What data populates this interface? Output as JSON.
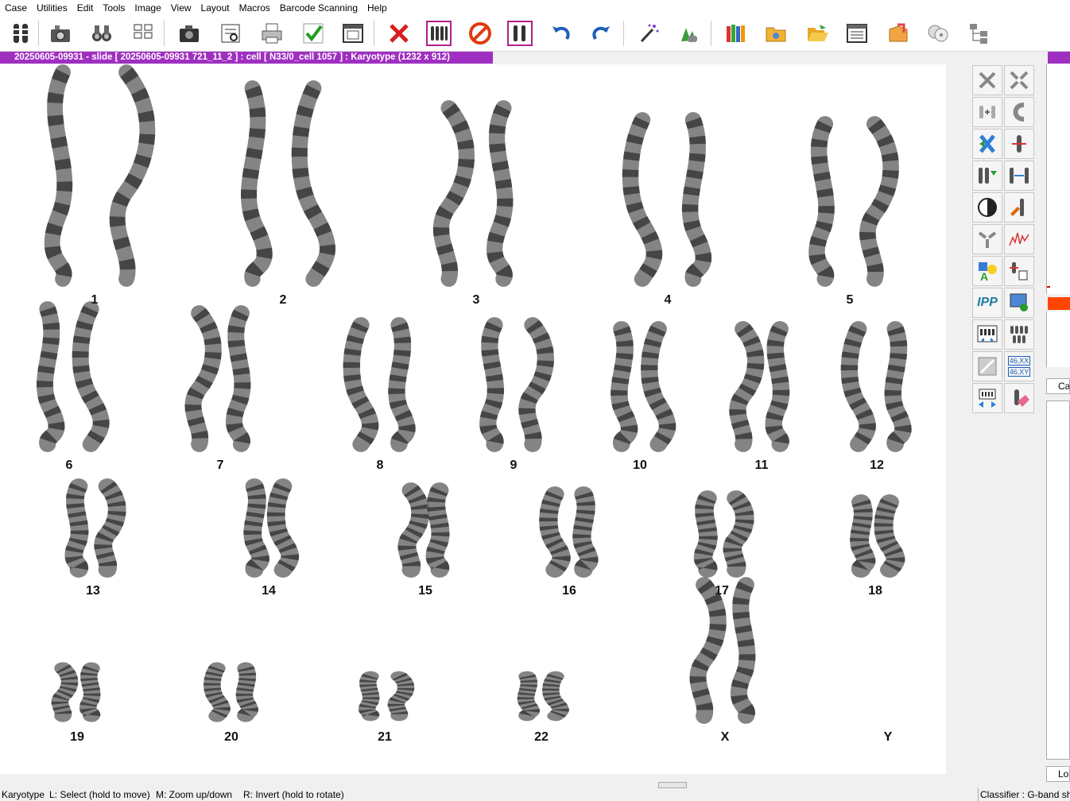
{
  "menu": [
    "Case",
    "Utilities",
    "Edit",
    "Tools",
    "Image",
    "View",
    "Layout",
    "Macros",
    "Barcode Scanning",
    "Help"
  ],
  "toolbar_icons": [
    "karyotype-icon",
    "capture-camera-icon",
    "binoculars-icon",
    "layout-grid-icon",
    "camera-icon",
    "inspect-icon",
    "print-icon",
    "checkmark-icon",
    "window-icon",
    "delete-x-icon",
    "karyotype-select-icon",
    "forbidden-icon",
    "chromosome-pair-icon",
    "undo-icon",
    "redo-icon",
    "magic-wand-icon",
    "pointing-hand-icon",
    "book-library-icon",
    "settings-folder-icon",
    "open-folder-icon",
    "report-icon",
    "export-icon",
    "discs-icon",
    "tree-icon"
  ],
  "window_title": "20250605-09931 - slide [ 20250605-09931 721_11_2 ] : cell [ N33/0_cell 1057 ] : Karyotype  (1232 x 912)",
  "chromosome_labels": [
    "1",
    "2",
    "3",
    "4",
    "5",
    "6",
    "7",
    "8",
    "9",
    "10",
    "11",
    "12",
    "13",
    "14",
    "15",
    "16",
    "17",
    "18",
    "19",
    "20",
    "21",
    "22",
    "X",
    "Y"
  ],
  "side_tools": [
    "delete-icon",
    "split-icon",
    "join-icon",
    "bend-icon",
    "swap-icon",
    "cut-chromosome-icon",
    "rearrange-icon",
    "stretch-icon",
    "contrast-icon",
    "paint-icon",
    "straighten-icon",
    "profile-icon",
    "annotate-icon",
    "hand-grab-icon",
    "ipp-icon",
    "monitor-icon",
    "karyotype-grid-icon",
    "pairs-icon",
    "measure-icon",
    "sex-karyotype-icon",
    "layout-arrows-icon",
    "eraser-icon"
  ],
  "side_texts": {
    "ipp": "IPP",
    "sex_top": "46,XX",
    "sex_bottom": "46,XY"
  },
  "right_panel": {
    "btn1": "Ca",
    "btn2": "Lo"
  },
  "status": {
    "mode": "Karyotype",
    "hint_left": "L: Select (hold to move)",
    "hint_middle": "M: Zoom up/down",
    "hint_right": "R: Invert (hold to rotate)",
    "classifier": "Classifier : G-band sho"
  },
  "colors": {
    "title_bar": "#9f2fc1",
    "accent_orange": "#ff4500"
  }
}
